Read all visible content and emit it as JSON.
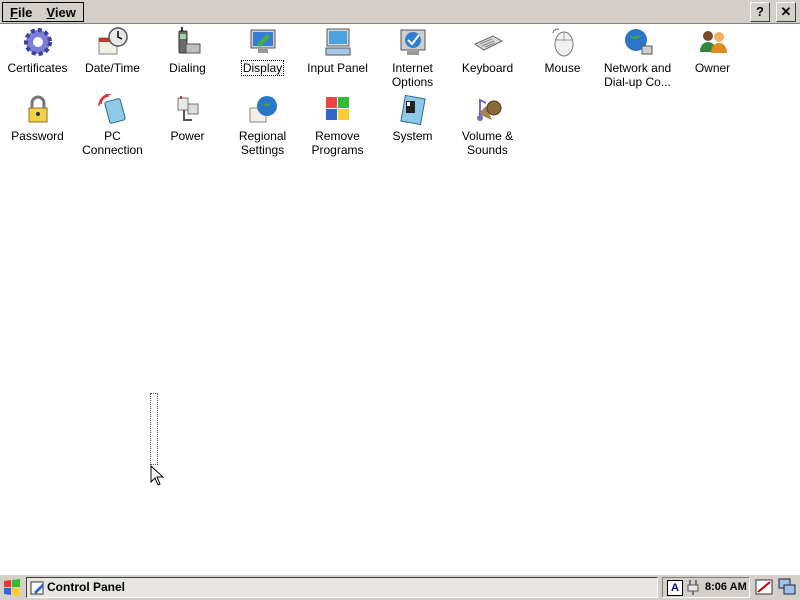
{
  "window_title": "Control Panel",
  "menu": {
    "file_prefix": "F",
    "file_rest": "ile",
    "view_prefix": "V",
    "view_rest": "iew"
  },
  "title_buttons": {
    "help": "?",
    "close": "✕"
  },
  "items": [
    {
      "label": "Certificates",
      "icon": "certificates-icon"
    },
    {
      "label": "Date/Time",
      "icon": "clock-calendar-icon"
    },
    {
      "label": "Dialing",
      "icon": "phone-icon"
    },
    {
      "label": "Display",
      "icon": "monitor-icon"
    },
    {
      "label": "Input Panel",
      "icon": "input-panel-icon"
    },
    {
      "label": "Internet\nOptions",
      "icon": "globe-check-icon"
    },
    {
      "label": "Keyboard",
      "icon": "keyboard-icon"
    },
    {
      "label": "Mouse",
      "icon": "mouse-icon"
    },
    {
      "label": "Network and\nDial-up Co...",
      "icon": "network-globe-icon"
    },
    {
      "label": "Owner",
      "icon": "users-icon"
    },
    {
      "label": "Password",
      "icon": "padlock-icon"
    },
    {
      "label": "PC\nConnection",
      "icon": "pc-connection-icon"
    },
    {
      "label": "Power",
      "icon": "power-plug-icon"
    },
    {
      "label": "Regional\nSettings",
      "icon": "globe-calendar-icon"
    },
    {
      "label": "Remove\nPrograms",
      "icon": "remove-programs-icon"
    },
    {
      "label": "System",
      "icon": "system-icon"
    },
    {
      "label": "Volume &\nSounds",
      "icon": "speaker-icon"
    }
  ],
  "focused_item": "Display",
  "taskbar": {
    "task_label": "Control Panel",
    "ime_label": "A",
    "clock": "8:06 AM"
  }
}
